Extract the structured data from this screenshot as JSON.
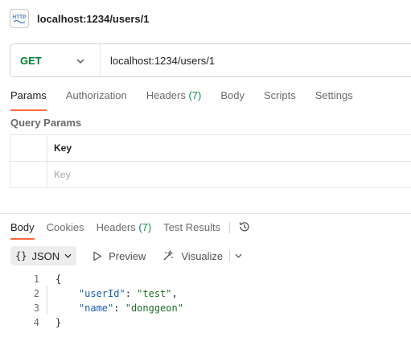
{
  "request": {
    "icon_label": "HTTP",
    "name": "localhost:1234/users/1",
    "method": "GET",
    "url": "localhost:1234/users/1",
    "tabs": [
      {
        "label": "Params",
        "count": ""
      },
      {
        "label": "Authorization",
        "count": ""
      },
      {
        "label": "Headers",
        "count": "(7)"
      },
      {
        "label": "Body",
        "count": ""
      },
      {
        "label": "Scripts",
        "count": ""
      },
      {
        "label": "Settings",
        "count": ""
      }
    ],
    "active_tab": "Params",
    "section_title": "Query Params",
    "params": {
      "header_key": "Key",
      "key_placeholder": "Key"
    }
  },
  "response": {
    "tabs": [
      {
        "label": "Body",
        "count": ""
      },
      {
        "label": "Cookies",
        "count": ""
      },
      {
        "label": "Headers",
        "count": "(7)"
      },
      {
        "label": "Test Results",
        "count": ""
      }
    ],
    "active_tab": "Body",
    "format": {
      "braces": "{}",
      "label": "JSON"
    },
    "preview_label": "Preview",
    "visualize_label": "Visualize",
    "code_lines": [
      {
        "num": "1",
        "indent": "",
        "key": "",
        "value": "",
        "text": "{"
      },
      {
        "num": "2",
        "indent": "    ",
        "key": "\"userId\"",
        "sep": ": ",
        "value": "\"test\"",
        "tail": ","
      },
      {
        "num": "3",
        "indent": "    ",
        "key": "\"name\"",
        "sep": ": ",
        "value": "\"donggeon\"",
        "tail": ""
      },
      {
        "num": "4",
        "indent": "",
        "key": "",
        "value": "",
        "text": "}"
      }
    ]
  },
  "colors": {
    "accent_tab": "#ff6c37",
    "method_get": "#007f31",
    "json_key": "#1c5fb0",
    "json_string": "#1b6e27"
  },
  "icons": [
    "http-icon",
    "chevron-down-icon",
    "history-icon",
    "play-icon",
    "visualize-icon"
  ]
}
